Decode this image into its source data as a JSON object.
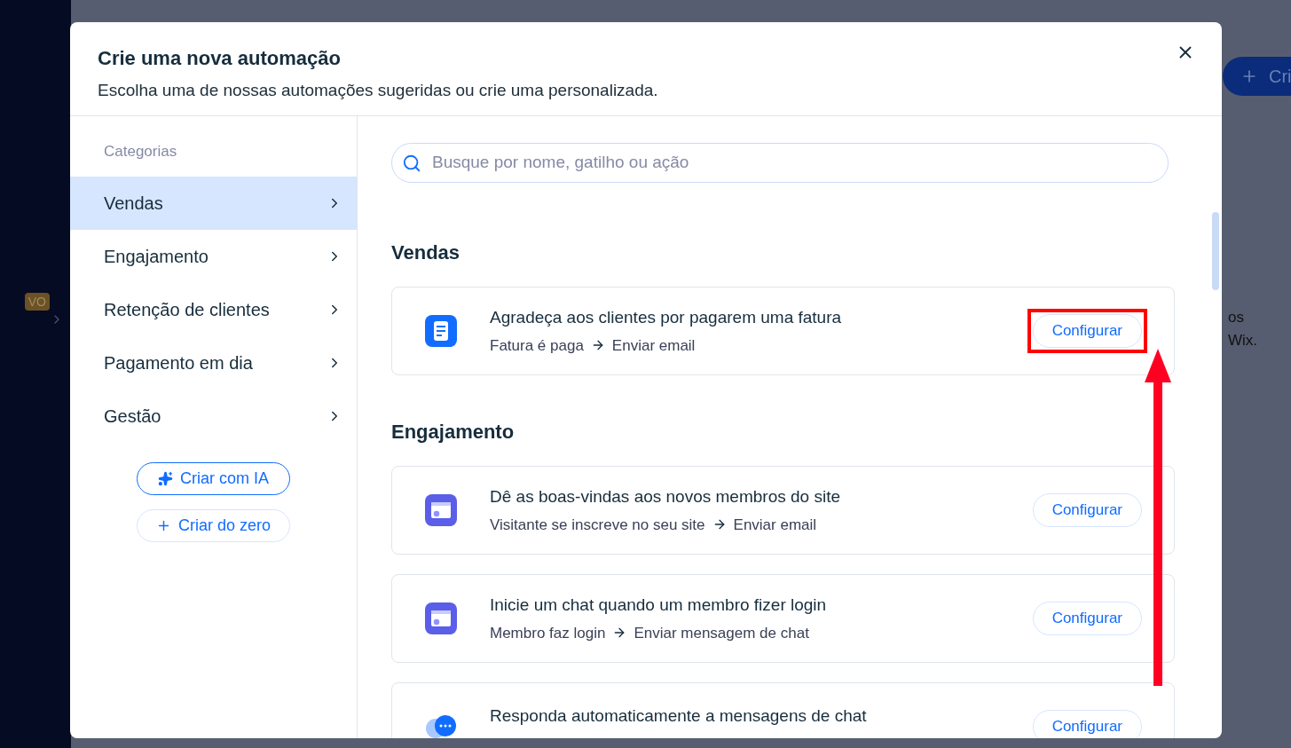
{
  "background": {
    "badge": "VO",
    "button": "Cri",
    "text_lines": [
      "os",
      "Wix."
    ]
  },
  "dialog": {
    "title": "Crie uma nova automação",
    "subtitle": "Escolha uma de nossas automações sugeridas ou crie uma personalizada."
  },
  "categories": {
    "heading": "Categorias",
    "items": [
      {
        "label": "Vendas",
        "selected": true
      },
      {
        "label": "Engajamento",
        "selected": false
      },
      {
        "label": "Retenção de clientes",
        "selected": false
      },
      {
        "label": "Pagamento em dia",
        "selected": false
      },
      {
        "label": "Gestão",
        "selected": false
      }
    ],
    "buttons": [
      {
        "kind": "ai",
        "label": "Criar com IA"
      },
      {
        "kind": "blank",
        "label": "Criar do zero"
      }
    ]
  },
  "search": {
    "placeholder": "Busque por nome, gatilho ou ação"
  },
  "sections": [
    {
      "title": "Vendas",
      "automations": [
        {
          "kind": "invoice",
          "title": "Agradeça aos clientes por pagarem uma fatura",
          "trigger": "Fatura é paga",
          "action": "Enviar email",
          "button": "Configurar",
          "highlighted": true
        }
      ]
    },
    {
      "title": "Engajamento",
      "automations": [
        {
          "kind": "member",
          "title": "Dê as boas-vindas aos novos membros do site",
          "trigger": "Visitante se inscreve no seu site",
          "action": "Enviar email",
          "button": "Configurar",
          "highlighted": false
        },
        {
          "kind": "member",
          "title": "Inicie um chat quando um membro fizer login",
          "trigger": "Membro faz login",
          "action": "Enviar mensagem de chat",
          "button": "Configurar",
          "highlighted": false
        },
        {
          "kind": "chat",
          "title": "Responda automaticamente a mensagens de chat",
          "button": "Configurar",
          "highlighted": false
        }
      ]
    }
  ]
}
